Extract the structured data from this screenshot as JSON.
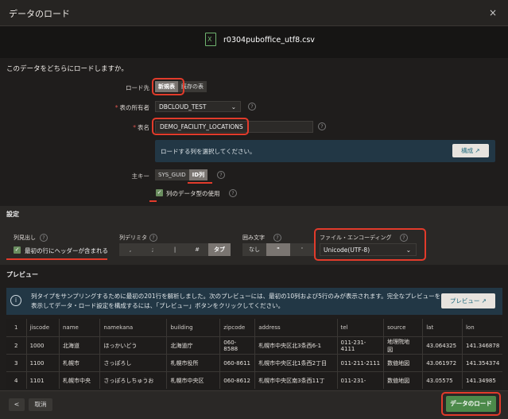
{
  "dialog": {
    "title": "データのロード",
    "close_icon": "×"
  },
  "file": {
    "name": "r0304puboffice_utf8.csv",
    "icon_letter": "X"
  },
  "question": "このデータをどちらにロードしますか。",
  "load_target": {
    "label": "ロード先",
    "options": [
      "新規表",
      "既存の表"
    ],
    "selected": "新規表"
  },
  "owner": {
    "label": "表の所有者",
    "value": "DBCLOUD_TEST"
  },
  "table_name": {
    "label": "表名",
    "value": "DEMO_FACILITY_LOCATIONS"
  },
  "columns_info": {
    "text": "ロードする列を選択してください。",
    "button": "構成"
  },
  "primary_key": {
    "label": "主キー",
    "options": [
      "SYS_GUID",
      "ID列"
    ],
    "selected": "ID列"
  },
  "use_column_types": {
    "label": "列のデータ型の使用",
    "checked": true
  },
  "settings": {
    "header": "設定",
    "column_header": {
      "label": "列見出し",
      "checkbox": "最初の行にヘッダーが含まれる",
      "checked": true
    },
    "delimiter": {
      "label": "列デリミタ",
      "options": [
        ",",
        ";",
        "|",
        "#",
        "タブ"
      ],
      "selected": "タブ"
    },
    "enclosure": {
      "label": "囲み文字",
      "options": [
        "なし",
        "\"",
        "'"
      ],
      "selected": "\""
    },
    "encoding": {
      "label": "ファイル・エンコーディング",
      "value": "Unicode(UTF-8)"
    }
  },
  "preview": {
    "header": "プレビュー",
    "info": "列タイプをサンプリングするために最初の201行を解析しました。次のプレビューには、最初の10列および5行のみが表示されます。完全なプレビューを表示してデータ・ロード設定を構成するには、「プレビュー」ボタンをクリックしてください。",
    "button": "プレビュー",
    "columns": [
      "1",
      "jiscode",
      "name",
      "namekana",
      "building",
      "zipcode",
      "address",
      "tel",
      "source",
      "lat",
      "lon"
    ],
    "rows": [
      [
        "2",
        "1000",
        "北海道",
        "ほっかいどう",
        "北海道庁",
        "060-\n8588",
        "札幌市中央区北3条西6-1",
        "011-231-\n4111",
        "地理院地\n図",
        "43.064325",
        "141.346878"
      ],
      [
        "3",
        "1100",
        "札幌市",
        "さっぽろし",
        "札幌市役所",
        "060-8611",
        "札幌市中央区北1条西2丁目",
        "011-211-2111",
        "数値地図",
        "43.061972",
        "141.354374"
      ],
      [
        "4",
        "1101",
        "札幌市中央",
        "さっぽろしちゅうお",
        "札幌市中央区",
        "060-8612",
        "札幌市中央区南3条西11丁",
        "011-231-",
        "数値地図",
        "43.05575",
        "141.34985"
      ]
    ]
  },
  "footer": {
    "back": "<",
    "cancel": "取消",
    "load": "データのロード"
  }
}
